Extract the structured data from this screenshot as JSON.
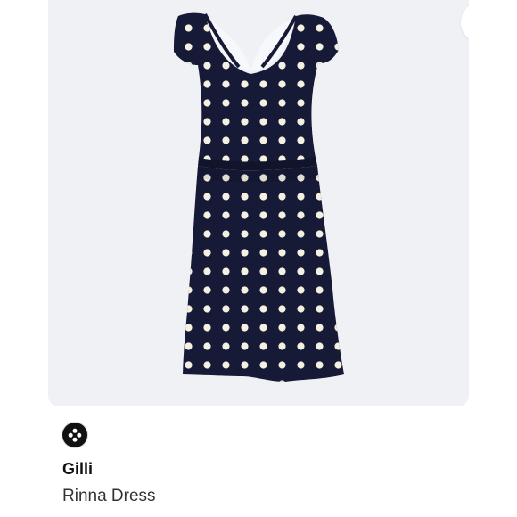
{
  "listing": {
    "brand": "Gilli",
    "product_name": "Rinna Dress"
  },
  "icons": {
    "more": "more-horizontal-icon",
    "brand_logo": "brand-logo"
  },
  "colors": {
    "card_background": "#f0f1f4",
    "dress_navy": "#161a36",
    "dots": "#f4f0e2",
    "more_dots": "#1f2a57"
  }
}
